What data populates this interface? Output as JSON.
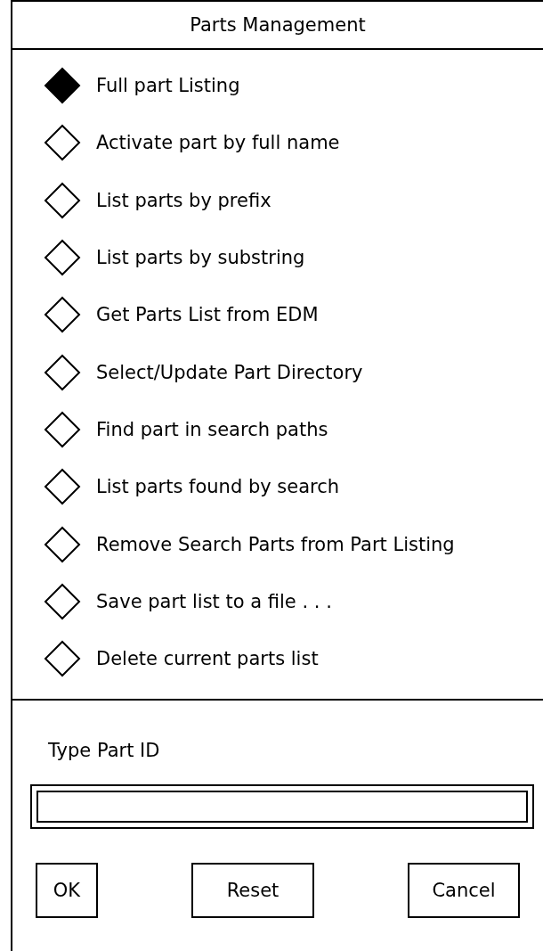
{
  "window": {
    "title": "Parts Management"
  },
  "options": [
    {
      "label": "Full part Listing",
      "selected": true
    },
    {
      "label": "Activate part by full name",
      "selected": false
    },
    {
      "label": "List parts by prefix",
      "selected": false
    },
    {
      "label": "List parts by substring",
      "selected": false
    },
    {
      "label": "Get Parts List from EDM",
      "selected": false
    },
    {
      "label": "Select/Update Part Directory",
      "selected": false
    },
    {
      "label": "Find part in search paths",
      "selected": false
    },
    {
      "label": "List parts found by search",
      "selected": false
    },
    {
      "label": "Remove Search Parts from Part Listing",
      "selected": false
    },
    {
      "label": "Save part list to a file . . .",
      "selected": false
    },
    {
      "label": "Delete current parts list",
      "selected": false
    }
  ],
  "part_id": {
    "label": "Type Part ID"
  },
  "buttons": [
    "OK",
    "Reset",
    "Cancel"
  ]
}
